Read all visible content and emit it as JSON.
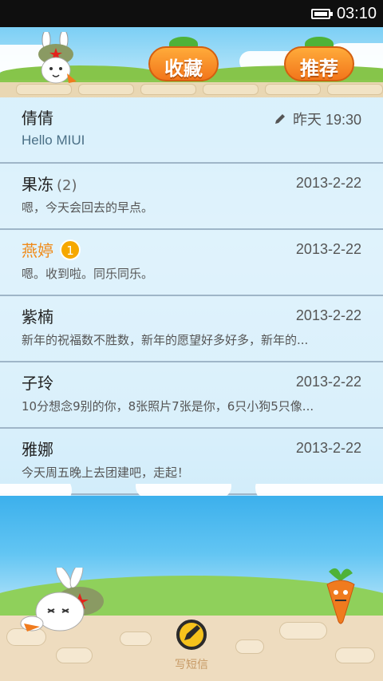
{
  "status_bar": {
    "time": "03:10"
  },
  "header": {
    "favorites_label": "收藏",
    "recommend_label": "推荐"
  },
  "conversations": [
    {
      "name": "倩倩",
      "count": "",
      "badge": "",
      "date": "昨天 19:30",
      "draft": true,
      "preview": "Hello MIUI",
      "unread": false
    },
    {
      "name": "果冻",
      "count": "(2)",
      "badge": "",
      "date": "2013-2-22",
      "draft": false,
      "preview": "嗯，今天会回去的早点。",
      "unread": false
    },
    {
      "name": "燕婷",
      "count": "",
      "badge": "1",
      "date": "2013-2-22",
      "draft": false,
      "preview": "嗯。收到啦。同乐同乐。",
      "unread": true
    },
    {
      "name": "紫楠",
      "count": "",
      "badge": "",
      "date": "2013-2-22",
      "draft": false,
      "preview": "新年的祝福数不胜数，新年的愿望好多好多，新年的...",
      "unread": false
    },
    {
      "name": "子玲",
      "count": "",
      "badge": "",
      "date": "2013-2-22",
      "draft": false,
      "preview": "10分想念9别的你，8张照片7张是你，6只小狗5只像...",
      "unread": false
    },
    {
      "name": "雅娜",
      "count": "",
      "badge": "",
      "date": "2013-2-22",
      "draft": false,
      "preview": "今天周五晚上去团建吧，走起！",
      "unread": false
    }
  ],
  "compose": {
    "label": "写短信"
  },
  "colors": {
    "unread_name": "#f08a17",
    "badge": "#f6a800",
    "status_bar": "#0f0f0f"
  }
}
